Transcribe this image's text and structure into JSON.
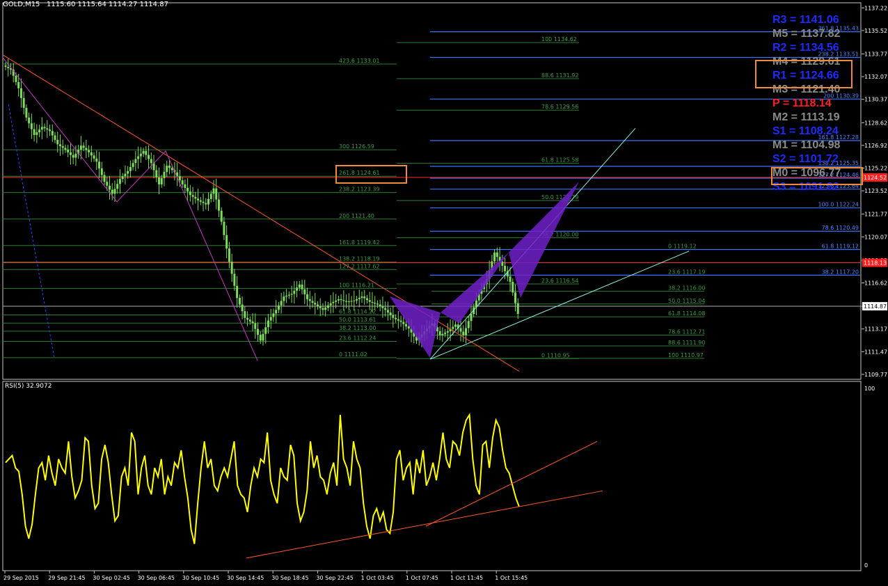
{
  "header": {
    "symbol": "GOLD,M15",
    "ohlc": "1115.60 1115.64 1114.27 1114.87"
  },
  "colors": {
    "background": "#000000",
    "price_candles": "#7ddc5b",
    "rsi_line": "#ffff00",
    "trendline": "#ff5a2a",
    "pattern_fill": "#7020c8",
    "fib_left": "#2e7d32",
    "fib_right": "#3a74ff",
    "pivot_resistance": "#1f2cff",
    "pivot_mid": "#8a8a8a",
    "pivot_pp": "#ff2020",
    "highlight_box": "#f08a3c"
  },
  "pivots": [
    {
      "label": "R3 = 1141.06",
      "kind": "resistance"
    },
    {
      "label": "M5 = 1137.82",
      "kind": "mid"
    },
    {
      "label": "R2 = 1134.56",
      "kind": "resistance"
    },
    {
      "label": "M4 = 1129.61",
      "kind": "mid"
    },
    {
      "label": "R1 = 1124.66",
      "kind": "resistance"
    },
    {
      "label": "M3 = 1121.40",
      "kind": "mid"
    },
    {
      "label": "P  = 1118.14",
      "kind": "pp"
    },
    {
      "label": "M2 = 1113.19",
      "kind": "mid"
    },
    {
      "label": "S1 = 1108.24",
      "kind": "resistance"
    },
    {
      "label": "M1 = 1104.98",
      "kind": "mid"
    },
    {
      "label": "S2 = 1101.72",
      "kind": "resistance"
    },
    {
      "label": "M0 = 1096.77",
      "kind": "mid"
    },
    {
      "label": "S3 = 1091.82",
      "kind": "resistance"
    }
  ],
  "rsi": {
    "title": "RSI(5) 32.9072"
  },
  "chart_data": [
    {
      "type": "candlestick",
      "title": "GOLD,M15",
      "x_ticks": [
        "29 Sep 2015",
        "29 Sep 21:45",
        "30 Sep 02:45",
        "30 Sep 06:45",
        "30 Sep 10:45",
        "30 Sep 14:45",
        "30 Sep 18:45",
        "30 Sep 22:45",
        "1 Oct 03:45",
        "1 Oct 07:45",
        "1 Oct 11:45",
        "1 Oct 15:45"
      ],
      "y_ticks": [
        1137.22,
        1135.52,
        1133.77,
        1132.07,
        1130.37,
        1128.62,
        1126.92,
        1125.22,
        1123.52,
        1121.77,
        1120.07,
        1118.32,
        1116.62,
        1114.87,
        1113.17,
        1111.47,
        1109.77
      ],
      "ylim": [
        1109.4,
        1137.6
      ],
      "current_price": 1114.87,
      "price_tags": [
        {
          "value": 1124.52,
          "bg": "#ff2020"
        },
        {
          "value": 1118.13,
          "bg": "#ff2020"
        },
        {
          "value": 1114.87,
          "bg": "#ffffff"
        }
      ],
      "close_path": [
        1132.9,
        1132.6,
        1131.2,
        1129.0,
        1127.7,
        1128.3,
        1128.0,
        1127.0,
        1126.6,
        1126.0,
        1126.9,
        1126.4,
        1125.7,
        1124.2,
        1123.3,
        1124.4,
        1125.0,
        1125.9,
        1126.5,
        1125.6,
        1124.0,
        1125.4,
        1124.9,
        1124.0,
        1123.2,
        1122.8,
        1122.5,
        1123.7,
        1121.2,
        1118.2,
        1115.5,
        1114.0,
        1113.6,
        1112.3,
        1113.8,
        1114.6,
        1115.6,
        1115.8,
        1116.5,
        1115.4,
        1115.0,
        1114.6,
        1115.1,
        1115.4,
        1115.2,
        1115.3,
        1115.6,
        1115.2,
        1115.0,
        1114.6,
        1114.0,
        1113.7,
        1113.2,
        1112.3,
        1113.0,
        1113.6,
        1112.7,
        1113.0,
        1113.5,
        1112.7,
        1114.3,
        1115.8,
        1116.9,
        1118.9,
        1117.9,
        1116.7,
        1114.3
      ],
      "pivot_lines": [
        {
          "price": 1118.13,
          "color": "#ff2a2a"
        },
        {
          "price": 1124.52,
          "color": "#ff2a2a"
        },
        {
          "price": 1114.87,
          "color": "#b0b0b0"
        }
      ],
      "fib_left": {
        "color": "#2e7d32",
        "levels": [
          "423.6 1133.01",
          "300 1126.59",
          "261.8 1124.61",
          "238.2 1123.39",
          "200 1121.40",
          "161.8 1119.42",
          "138.2 1118.19",
          "127.2 1117.62",
          "100 1116.21",
          "61.8 1114.22",
          "50.0 1113.61",
          "38.2 1113.00",
          "23.6 1112.24",
          "0 1111.02"
        ],
        "values": [
          1133.01,
          1126.59,
          1124.61,
          1123.39,
          1121.4,
          1119.42,
          1118.19,
          1117.62,
          1116.21,
          1114.22,
          1113.61,
          1113.0,
          1112.24,
          1111.02
        ]
      },
      "fib_mid": {
        "color": "#2e7d32",
        "levels": [
          "100 1134.62",
          "88.6 1131.92",
          "78.6 1129.56",
          "61.8 1125.58",
          "50.0 1122.79",
          "38.2 1120.00",
          "23.6 1116.54",
          "0 1110.95"
        ],
        "values": [
          1134.62,
          1131.92,
          1129.56,
          1125.58,
          1122.79,
          1120.0,
          1116.54,
          1110.95
        ]
      },
      "fib_center": {
        "color": "#2e7d32",
        "levels": [
          "0 1119.12",
          "23.6 1117.19",
          "38.2 1116.00",
          "50.0 1115.04",
          "61.8 1114.08",
          "78.6 1112.71",
          "88.6 1111.90",
          "100 1110.97"
        ],
        "values": [
          1119.12,
          1117.19,
          1116.0,
          1115.04,
          1114.08,
          1112.71,
          1111.9,
          1110.97
        ]
      },
      "fib_right": {
        "color": "#3a74ff",
        "levels": [
          "361.8 1135.43",
          "238.2 1133.51",
          "200 1130.39",
          "161.8 1127.28",
          "138.2 1125.35",
          "127.2 1124.46",
          "123.6 1123.64",
          "100.0 1122.24",
          "78.6 1120.49",
          "61.8 1119.12",
          "38.2 1117.20"
        ],
        "values": [
          1135.43,
          1133.51,
          1130.39,
          1127.28,
          1125.35,
          1124.46,
          1123.64,
          1122.24,
          1120.49,
          1119.12,
          1117.2
        ]
      }
    },
    {
      "type": "line",
      "title": "RSI(5) 32.9072",
      "ylim": [
        0,
        100
      ],
      "y_ticks": [
        100,
        0
      ],
      "series": [
        {
          "values": [
            58,
            60,
            62,
            55,
            53,
            40,
            22,
            15,
            23,
            40,
            55,
            58,
            48,
            62,
            52,
            45,
            60,
            55,
            52,
            70,
            50,
            38,
            42,
            48,
            72,
            70,
            45,
            32,
            35,
            60,
            68,
            58,
            40,
            25,
            28,
            50,
            55,
            45,
            75,
            70,
            40,
            55,
            62,
            45,
            40,
            55,
            50,
            60,
            40,
            50,
            45,
            58,
            55,
            65,
            50,
            38,
            20,
            12,
            35,
            55,
            70,
            55,
            60,
            45,
            42,
            50,
            55,
            50,
            60,
            70,
            45,
            40,
            38,
            30,
            45,
            55,
            50,
            60,
            58,
            75,
            48,
            40,
            35,
            55,
            50,
            48,
            68,
            62,
            35,
            25,
            30,
            42,
            70,
            55,
            62,
            50,
            48,
            40,
            52,
            58,
            45,
            85,
            60,
            55,
            45,
            70,
            60,
            55,
            35,
            22,
            15,
            28,
            32,
            25,
            30,
            20,
            18,
            30,
            60,
            65,
            48,
            55,
            58,
            40,
            60,
            52,
            65,
            45,
            50,
            58,
            48,
            60,
            75,
            60,
            55,
            70,
            68,
            62,
            75,
            82,
            85,
            60,
            45,
            40,
            68,
            70,
            55,
            72,
            82,
            78,
            65,
            55,
            52,
            45,
            38,
            33
          ]
        }
      ]
    }
  ]
}
